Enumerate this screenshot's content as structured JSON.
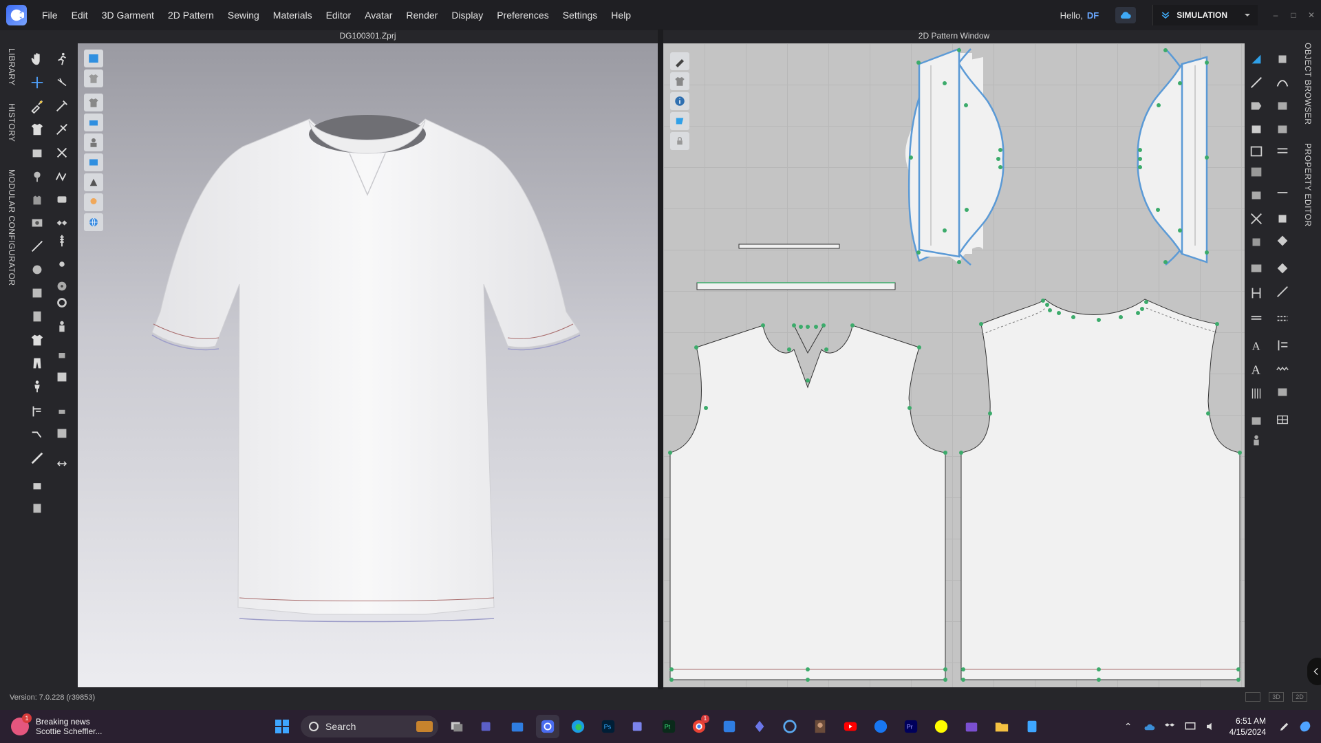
{
  "menu": {
    "items": [
      "File",
      "Edit",
      "3D Garment",
      "2D Pattern",
      "Sewing",
      "Materials",
      "Editor",
      "Avatar",
      "Render",
      "Display",
      "Preferences",
      "Settings",
      "Help"
    ],
    "greeting": "Hello,",
    "user": "DF",
    "mode": "SIMULATION"
  },
  "left_tabs": [
    "LIBRARY",
    "HISTORY",
    "MODULAR CONFIGURATOR"
  ],
  "right_tabs": [
    "OBJECT BROWSER",
    "PROPERTY EDITOR"
  ],
  "viewport3d": {
    "title": "DG100301.Zprj"
  },
  "viewport2d": {
    "title": "2D Pattern Window"
  },
  "status": {
    "version": "Version: 7.0.228 (r39853)",
    "view_labels": [
      "3D",
      "2D"
    ]
  },
  "taskbar": {
    "news_title": "Breaking news",
    "news_sub": "Scottie Scheffler...",
    "news_badge": "1",
    "search_placeholder": "Search",
    "clock_time": "6:51 AM",
    "clock_date": "4/15/2024",
    "chrome_badge": "1",
    "apps": [
      "task-view",
      "teams",
      "store",
      "clo3d",
      "edge",
      "photoshop",
      "teams-work",
      "pt",
      "chrome",
      "maps",
      "copilot",
      "cortana",
      "photo",
      "youtube",
      "facebook",
      "premiere",
      "snapchat",
      "clapper",
      "explorer",
      "notepad"
    ]
  },
  "colors": {
    "accent": "#3d6cf4",
    "pattern_outline_selected": "#5b9ad6",
    "point": "#3cab6b"
  }
}
